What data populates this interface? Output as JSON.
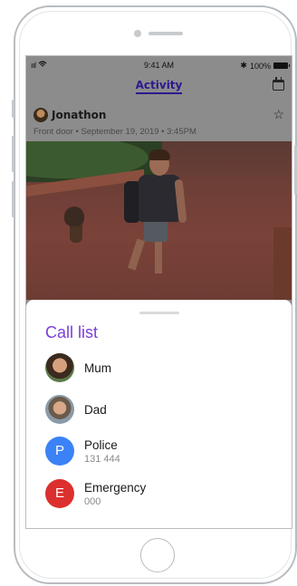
{
  "status_bar": {
    "signal": "ııl",
    "wifi_icon": "wifi-icon",
    "time": "9:41 AM",
    "bluetooth": "✱",
    "battery_percent": "100%"
  },
  "nav": {
    "title": "Activity",
    "calendar_icon": "calendar-icon"
  },
  "event": {
    "person": "Jonathon",
    "meta": "Front door • September 19, 2019 • 3:45PM",
    "star_icon": "☆"
  },
  "call_list": {
    "title": "Call list",
    "contacts": [
      {
        "name": "Mum",
        "sub": "",
        "initial": "",
        "avatar_type": "photo"
      },
      {
        "name": "Dad",
        "sub": "",
        "initial": "",
        "avatar_type": "photo"
      },
      {
        "name": "Police",
        "sub": "131 444",
        "initial": "P",
        "color": "#3b82f6"
      },
      {
        "name": "Emergency",
        "sub": "000",
        "initial": "E",
        "color": "#dc2f2f"
      }
    ]
  },
  "colors": {
    "accent_purple": "#7b3fd9",
    "nav_title": "#2c1a8e"
  }
}
